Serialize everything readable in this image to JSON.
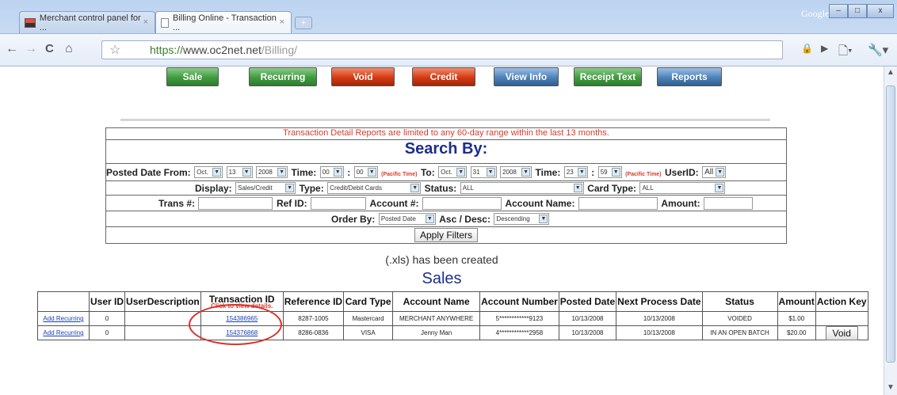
{
  "browser": {
    "tabs": [
      {
        "title": "Merchant control panel for ...",
        "close": "×"
      },
      {
        "title": "Billing Online - Transaction ...",
        "close": "×"
      }
    ],
    "new_tab_label": "+",
    "google_label": "Google",
    "window_buttons": {
      "minimize": "–",
      "maximize": "□",
      "close": "x"
    },
    "nav": {
      "back": "←",
      "forward": "→",
      "reload": "C",
      "home": "⌂",
      "star": "☆"
    },
    "url": {
      "protocol": "https://",
      "host": "www.oc2net.net",
      "path": "/Billing/"
    },
    "icons": {
      "lock": "🔒",
      "play": "▶",
      "page": "🗋▾",
      "wrench": "🔧▾"
    }
  },
  "nav_buttons": [
    {
      "label": "Sale",
      "color": "green"
    },
    {
      "label": "Recurring",
      "color": "green"
    },
    {
      "label": "Void",
      "color": "red"
    },
    {
      "label": "Credit",
      "color": "red"
    },
    {
      "label": "View Info",
      "color": "blue"
    },
    {
      "label": "Receipt Text",
      "color": "green"
    },
    {
      "label": "Reports",
      "color": "blue"
    }
  ],
  "search": {
    "notice": "Transaction Detail Reports are limited to any 60-day range within the last 13 months.",
    "title": "Search By:",
    "posted_from_label": "Posted Date From:",
    "from_month": "Oct.",
    "from_day": "13",
    "from_year": "2008",
    "time_label": "Time:",
    "from_hour": "00",
    "from_minute": "00",
    "pacific_time": "(Pacific Time)",
    "to_label": "To:",
    "to_month": "Oct.",
    "to_day": "31",
    "to_year": "2008",
    "to_hour": "23",
    "to_minute": "59",
    "userid_label": "UserID:",
    "userid_value": "All",
    "display_label": "Display:",
    "display_value": "Sales/Credit",
    "type_label": "Type:",
    "type_value": "Credit/Debit Cards",
    "status_label": "Status:",
    "status_value": "ALL",
    "card_type_label": "Card Type:",
    "card_type_value": "ALL",
    "trans_label": "Trans #:",
    "refid_label": "Ref ID:",
    "account_label": "Account #:",
    "account_name_label": "Account Name:",
    "amount_label": "Amount:",
    "order_label": "Order By:",
    "order_value": "Posted Date",
    "asc_label": "Asc / Desc:",
    "asc_value": "Descending",
    "apply_label": "Apply Filters",
    "colon": ":"
  },
  "xls_message": "(.xls) has been created",
  "sales_title": "Sales",
  "table": {
    "headers": [
      "",
      "User ID",
      "UserDescription",
      "Transaction ID",
      "Reference ID",
      "Card Type",
      "Account Name",
      "Account Number",
      "Posted Date",
      "Next Process Date",
      "Status",
      "Amount",
      "Action Key"
    ],
    "hint": "Click to view details.",
    "rows": [
      {
        "action": "Add Recurring",
        "user_id": "0",
        "user_desc": "",
        "txn_id": "154386965",
        "ref_id": "8287-1005",
        "card_type": "Mastercard",
        "account_name": "MERCHANT ANYWHERE",
        "account_number": "5************9123",
        "posted": "10/13/2008",
        "next": "10/13/2008",
        "status": "VOIDED",
        "amount": "$1.00",
        "key": ""
      },
      {
        "action": "Add Recurring",
        "user_id": "0",
        "user_desc": "",
        "txn_id": "154376868",
        "ref_id": "8286-0836",
        "card_type": "VISA",
        "account_name": "Jenny Man",
        "account_number": "4************2958",
        "posted": "10/13/2008",
        "next": "10/13/2008",
        "status": "IN AN OPEN BATCH",
        "amount": "$20.00",
        "key": "Void"
      }
    ]
  },
  "colors": {
    "notice_red": "#d83a2a",
    "title_blue": "#1c2f8c",
    "link_blue": "#1a3fb5"
  }
}
